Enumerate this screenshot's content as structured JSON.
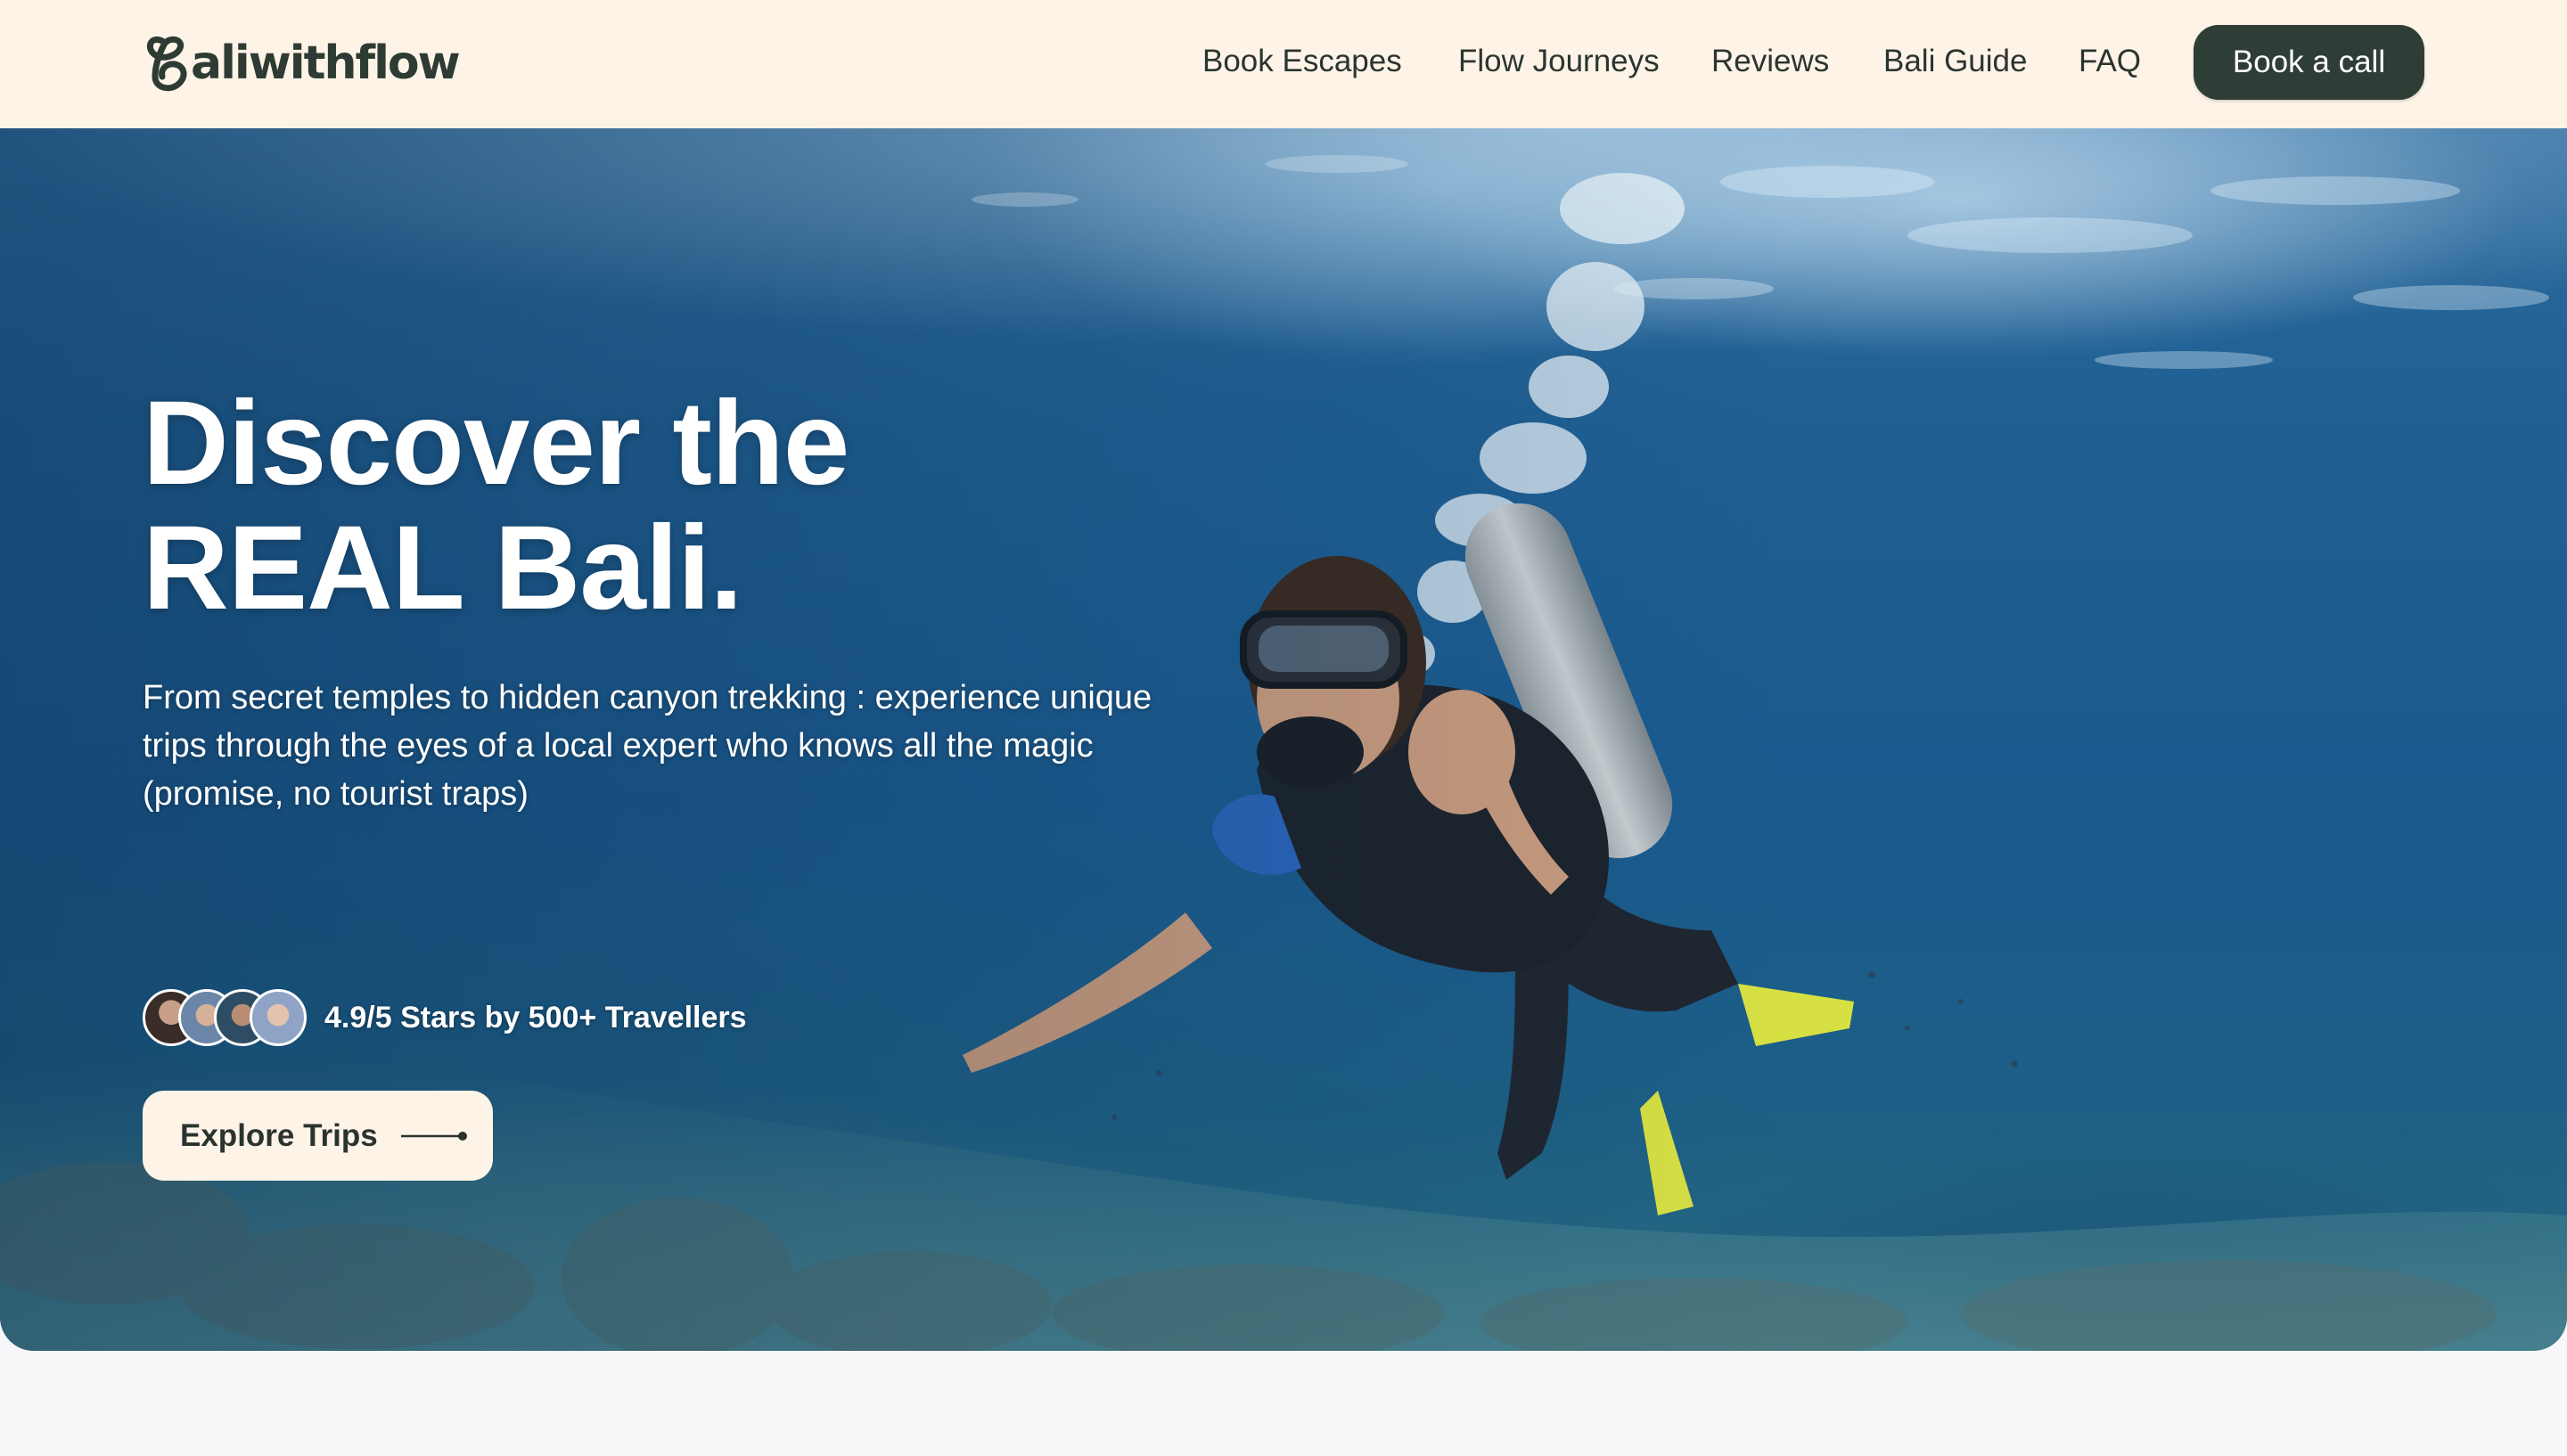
{
  "brand": {
    "name": "Baliwithflow",
    "logo_text": "aliwithflow"
  },
  "nav": {
    "links": [
      {
        "label": "Book Escapes"
      },
      {
        "label": "Flow Journeys"
      },
      {
        "label": "Reviews"
      },
      {
        "label": "Bali Guide"
      },
      {
        "label": "FAQ"
      }
    ],
    "cta_label": "Book a call"
  },
  "hero": {
    "title_line1": "Discover the",
    "title_line2": "REAL Bali.",
    "subtitle": "From secret temples to hidden canyon trekking : experience unique trips through the eyes of a local expert who knows all the magic (promise, no tourist traps)",
    "rating_text": "4.9/5 Stars by 500+ Travellers",
    "avatars": [
      "traveller-avatar-1",
      "traveller-avatar-2",
      "traveller-avatar-3",
      "traveller-avatar-4"
    ],
    "button_label": "Explore Trips",
    "button_icon": "arrow-right-icon",
    "background": "scuba-diver-underwater-photo"
  },
  "colors": {
    "header_bg": "#fdf4e7",
    "cta_bg": "#2f3d37",
    "text_dark": "#2b3430",
    "page_bg": "#f8f8fa"
  }
}
